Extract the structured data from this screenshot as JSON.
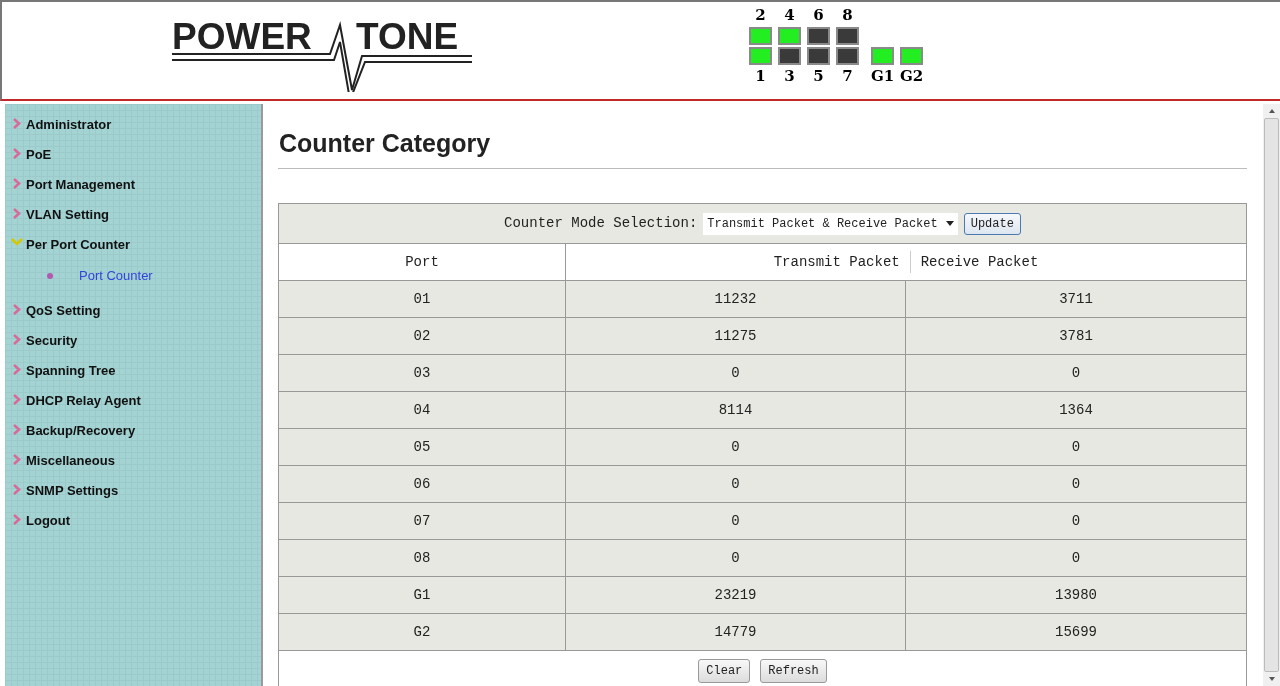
{
  "logo": {
    "left": "POWER",
    "right": "TONE"
  },
  "ports_top": [
    {
      "label": "2",
      "up": true
    },
    {
      "label": "4",
      "up": true
    },
    {
      "label": "6",
      "up": false
    },
    {
      "label": "8",
      "up": false
    }
  ],
  "ports_bottom": [
    {
      "label": "1",
      "up": true
    },
    {
      "label": "3",
      "up": false
    },
    {
      "label": "5",
      "up": false
    },
    {
      "label": "7",
      "up": false
    },
    {
      "label": "G1",
      "up": true
    },
    {
      "label": "G2",
      "up": true
    }
  ],
  "sidebar": {
    "items": [
      {
        "label": "Administrator",
        "expanded": false
      },
      {
        "label": "PoE",
        "expanded": false
      },
      {
        "label": "Port Management",
        "expanded": false
      },
      {
        "label": "VLAN Setting",
        "expanded": false
      },
      {
        "label": "Per Port Counter",
        "expanded": true,
        "children": [
          {
            "label": "Port Counter",
            "selected": true
          }
        ]
      },
      {
        "label": "QoS Setting",
        "expanded": false
      },
      {
        "label": "Security",
        "expanded": false
      },
      {
        "label": "Spanning Tree",
        "expanded": false
      },
      {
        "label": "DHCP Relay Agent",
        "expanded": false
      },
      {
        "label": "Backup/Recovery",
        "expanded": false
      },
      {
        "label": "Miscellaneous",
        "expanded": false
      },
      {
        "label": "SNMP Settings",
        "expanded": false
      },
      {
        "label": "Logout",
        "expanded": false
      }
    ]
  },
  "page_title": "Counter Category",
  "mode": {
    "label": "Counter Mode Selection:",
    "value": "Transmit Packet & Receive Packet",
    "button": "Update"
  },
  "table": {
    "columns": [
      "Port",
      "Transmit Packet",
      "Receive Packet"
    ],
    "rows": [
      [
        "01",
        "11232",
        "3711"
      ],
      [
        "02",
        "11275",
        "3781"
      ],
      [
        "03",
        "0",
        "0"
      ],
      [
        "04",
        "8114",
        "1364"
      ],
      [
        "05",
        "0",
        "0"
      ],
      [
        "06",
        "0",
        "0"
      ],
      [
        "07",
        "0",
        "0"
      ],
      [
        "08",
        "0",
        "0"
      ],
      [
        "G1",
        "23219",
        "13980"
      ],
      [
        "G2",
        "14779",
        "15699"
      ]
    ]
  },
  "buttons": [
    "Clear",
    "Refresh"
  ]
}
